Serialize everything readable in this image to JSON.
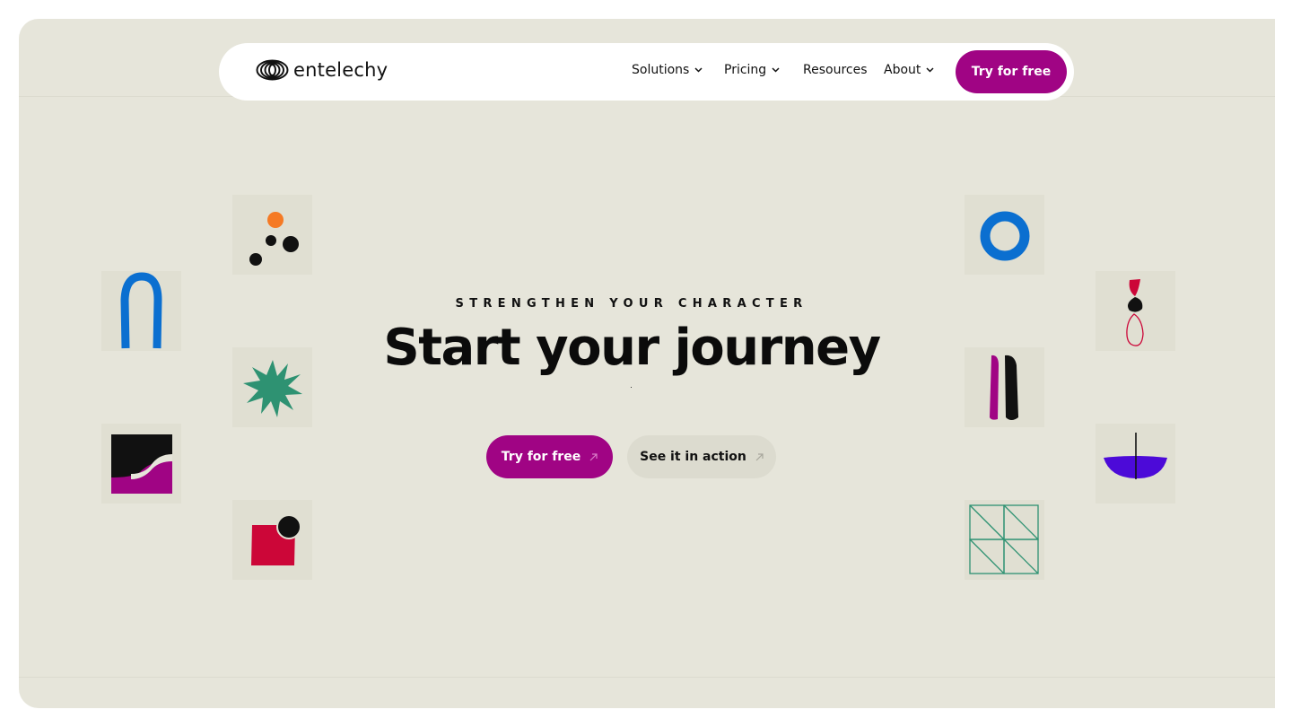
{
  "nav": {
    "brand": "entelechy",
    "items": [
      {
        "label": "Solutions",
        "has_dropdown": true
      },
      {
        "label": "Pricing",
        "has_dropdown": true
      },
      {
        "label": "Resources",
        "has_dropdown": false
      },
      {
        "label": "About",
        "has_dropdown": true
      }
    ],
    "cta_label": "Try for free"
  },
  "hero": {
    "eyebrow": "STRENGTHEN YOUR CHARACTER",
    "headline": "Start your journey",
    "primary_button": "Try for free",
    "secondary_button": "See it in action"
  },
  "tiles": [
    "blue-arch-icon",
    "dots-cluster-icon",
    "green-star-icon",
    "black-magenta-wave-icon",
    "red-square-dot-icon",
    "blue-ring-icon",
    "magenta-black-stripes-icon",
    "stacked-stones-icon",
    "green-triangle-grid-icon",
    "purple-bowl-icon"
  ],
  "colors": {
    "background": "#e6e5da",
    "tile": "#e0dfd2",
    "accent": "#a00484",
    "blue": "#0b6fd0",
    "green": "#2e9272",
    "red": "#cc0638",
    "orange": "#f57a25",
    "purple": "#4c0ad8",
    "text": "#111111"
  }
}
